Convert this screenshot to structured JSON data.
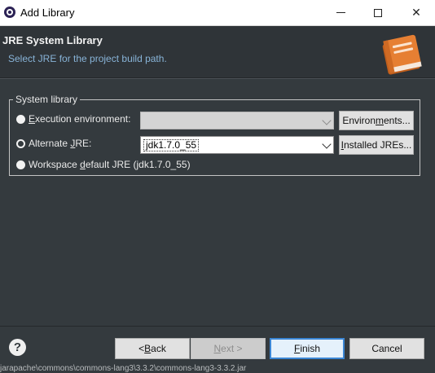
{
  "window": {
    "title": "Add Library",
    "minimize_icon": "minimize-icon",
    "maximize_icon": "maximize-icon",
    "close_glyph": "✕"
  },
  "header": {
    "title": "JRE System Library",
    "subtitle": "Select JRE for the project build path.",
    "icon": "book-icon",
    "accent_color": "#e67f33"
  },
  "group": {
    "legend": "System library",
    "options": [
      {
        "label_pre": "",
        "mnemonic": "E",
        "label_post": "xecution environment:",
        "selected": false
      },
      {
        "label_pre": "Alternate ",
        "mnemonic": "J",
        "label_post": "RE:",
        "selected": true
      },
      {
        "label_pre": "Workspace ",
        "mnemonic": "d",
        "label_post": "efault JRE (jdk1.7.0_55)",
        "selected": false
      }
    ],
    "env_combo_value": "",
    "alt_combo_value": "jdk1.7.0_55",
    "environments_button": {
      "pre": "Environ",
      "mnemonic": "m",
      "post": "ents..."
    },
    "installed_button": {
      "pre": "",
      "mnemonic": "I",
      "post": "nstalled JREs..."
    }
  },
  "footer": {
    "help_glyph": "?",
    "back": {
      "pre": "< ",
      "mnemonic": "B",
      "post": "ack"
    },
    "next": {
      "pre": "",
      "mnemonic": "N",
      "post": "ext >"
    },
    "finish": {
      "pre": "",
      "mnemonic": "F",
      "post": "inish"
    },
    "cancel": "Cancel"
  },
  "background_text": "jarapache\\commons\\commons-lang3\\3.3.2\\commons-lang3-3.3.2.jar"
}
